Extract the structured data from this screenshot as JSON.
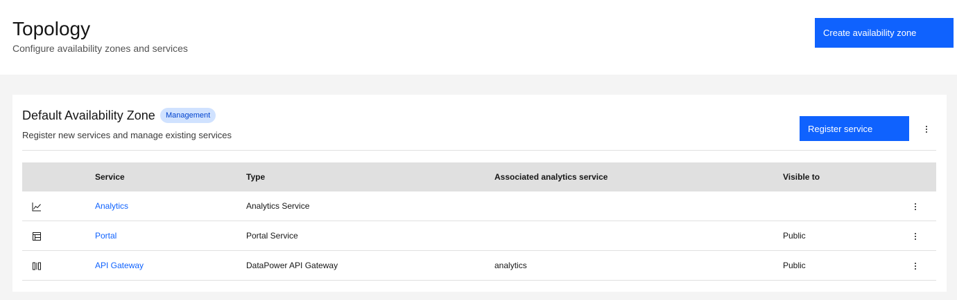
{
  "header": {
    "title": "Topology",
    "subtitle": "Configure availability zones and services",
    "create_button_label": "Create availability zone"
  },
  "zone": {
    "title": "Default Availability Zone",
    "badge": "Management",
    "description": "Register new services and manage existing services",
    "register_button_label": "Register service",
    "overflow_icon": "overflow-menu-vertical-icon"
  },
  "table": {
    "columns": {
      "service": "Service",
      "type": "Type",
      "associated_analytics": "Associated analytics service",
      "visible_to": "Visible to"
    },
    "rows": [
      {
        "icon": "analytics-chart-icon",
        "service": "Analytics",
        "type": "Analytics Service",
        "associated_analytics": "",
        "visible_to": ""
      },
      {
        "icon": "portal-table-icon",
        "service": "Portal",
        "type": "Portal Service",
        "associated_analytics": "",
        "visible_to": "Public"
      },
      {
        "icon": "gateway-icon",
        "service": "API Gateway",
        "type": "DataPower API Gateway",
        "associated_analytics": "analytics",
        "visible_to": "Public"
      }
    ]
  },
  "colors": {
    "primary_button": "#0f62fe",
    "link": "#0f62fe",
    "badge_bg": "#d0e2ff",
    "badge_text": "#0043ce",
    "table_header_bg": "#e0e0e0",
    "page_bg": "#f4f4f4"
  }
}
